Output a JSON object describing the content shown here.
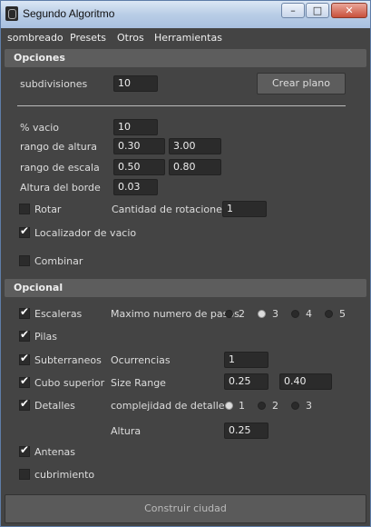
{
  "window": {
    "title": "Segundo Algoritmo",
    "min_icon": "minimize-icon",
    "max_icon": "maximize-icon",
    "close_icon": "close-icon"
  },
  "menu": [
    "sombreado",
    "Presets",
    "Otros",
    "Herramientas"
  ],
  "opciones": {
    "header": "Opciones",
    "subdivisiones_label": "subdivisiones",
    "subdivisiones_value": "10",
    "crear_plano": "Crear plano",
    "vacio_label": "% vacio",
    "vacio_value": "10",
    "altura_label": "rango de altura",
    "altura_min": "0.30",
    "altura_max": "3.00",
    "escala_label": "rango de escala",
    "escala_min": "0.50",
    "escala_max": "0.80",
    "borde_label": "Altura del borde",
    "borde_value": "0.03",
    "rotar_label": "Rotar",
    "rotar_checked": false,
    "rotaciones_label": "Cantidad de rotaciones",
    "rotaciones_value": "1",
    "localizador_label": "Localizador de vacio",
    "localizador_checked": true,
    "combinar_label": "Combinar",
    "combinar_checked": false
  },
  "opcional": {
    "header": "Opcional",
    "escaleras_label": "Escaleras",
    "escaleras_checked": true,
    "pasos_label": "Maximo numero de pasos",
    "pasos_options": [
      "2",
      "3",
      "4",
      "5"
    ],
    "pasos_selected": "3",
    "pilas_label": "Pilas",
    "pilas_checked": true,
    "subterraneos_label": "Subterraneos",
    "subterraneos_checked": true,
    "ocurrencias_label": "Ocurrencias",
    "ocurrencias_value": "1",
    "cubo_label": "Cubo superior",
    "cubo_checked": true,
    "size_label": "Size Range",
    "size_min": "0.25",
    "size_max": "0.40",
    "detalles_label": "Detalles",
    "detalles_checked": true,
    "complejidad_label": "complejidad de detalle",
    "complejidad_options": [
      "1",
      "2",
      "3"
    ],
    "complejidad_selected": "1",
    "altura_label": "Altura",
    "altura_value": "0.25",
    "antenas_label": "Antenas",
    "antenas_checked": true,
    "cubrimiento_label": "cubrimiento",
    "cubrimiento_checked": false
  },
  "construir": "Construir ciudad",
  "colors": {
    "background": "#444444",
    "field": "#2b2b2b",
    "header": "#5d5d5d",
    "titlebar": "#b9cde6"
  }
}
